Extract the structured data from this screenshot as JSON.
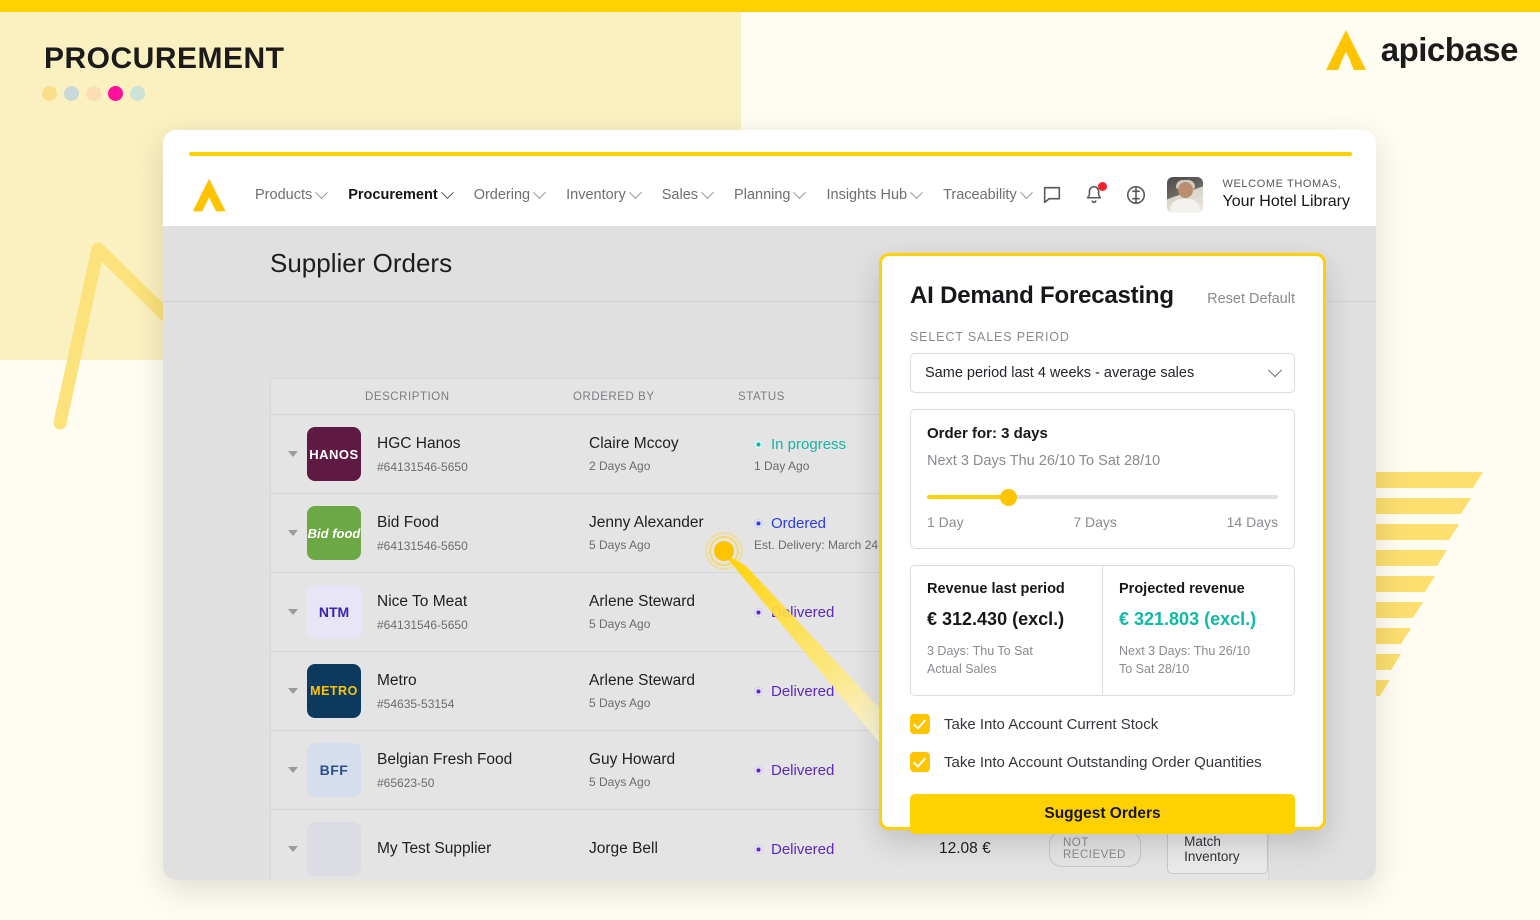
{
  "page": {
    "kicker": "PROCUREMENT",
    "dot_colors": [
      "#FBDE8A",
      "#C8D8DB",
      "#FBDEB2",
      "#FF0F9B",
      "#CBE5D4"
    ],
    "brand_name": "apicbase",
    "accent_yellow": "#FFD100",
    "cream": "#FAF0C0",
    "background": "#FFFDF2"
  },
  "nav": {
    "items": [
      {
        "label": "Products",
        "active": false
      },
      {
        "label": "Procurement",
        "active": true
      },
      {
        "label": "Ordering",
        "active": false
      },
      {
        "label": "Inventory",
        "active": false
      },
      {
        "label": "Sales",
        "active": false
      },
      {
        "label": "Planning",
        "active": false
      },
      {
        "label": "Insights Hub",
        "active": false
      },
      {
        "label": "Traceability",
        "active": false
      }
    ],
    "icons": [
      "chat-icon",
      "notifications-icon",
      "help-icon"
    ],
    "user": {
      "welcome": "WELCOME THOMAS,",
      "organisation": "Your Hotel Library"
    }
  },
  "main": {
    "page_title": "Supplier Orders",
    "table": {
      "columns": [
        "DESCRIPTION",
        "ORDERED BY",
        "STATUS"
      ],
      "rows": [
        {
          "supplier": "HGC Hanos",
          "reference": "#64131546-5650",
          "ordered_by": "Claire Mccoy",
          "ordered_when": "2 Days Ago",
          "status": "In progress",
          "status_color": "#16B3A6",
          "status_sub": "1 Day Ago",
          "logo_text": "HANOS",
          "logo_bg": "#5E1A42",
          "logo_fg": "#FFFFFF"
        },
        {
          "supplier": "Bid Food",
          "reference": "#64131546-5650",
          "ordered_by": "Jenny Alexander",
          "ordered_when": "5 Days Ago",
          "status": "Ordered",
          "status_color": "#2C3BE0",
          "status_sub": "Est. Delivery: March 24",
          "logo_text": "Bid food",
          "logo_bg": "#6CA843",
          "logo_fg": "#FFFFFF"
        },
        {
          "supplier": "Nice To Meat",
          "reference": "#64131546-5650",
          "ordered_by": "Arlene Steward",
          "ordered_when": "5 Days Ago",
          "status": "Delivered",
          "status_color": "#5B27C4",
          "status_sub": "",
          "logo_text": "NTM",
          "logo_bg": "#E8E5F7",
          "logo_fg": "#3B23B0"
        },
        {
          "supplier": "Metro",
          "reference": "#54635-53154",
          "ordered_by": "Arlene Steward",
          "ordered_when": "5 Days Ago",
          "status": "Delivered",
          "status_color": "#5B27C4",
          "status_sub": "",
          "logo_text": "METRO",
          "logo_bg": "#0C3A5E",
          "logo_fg": "#FFC400"
        },
        {
          "supplier": "Belgian Fresh Food",
          "reference": "#65623-50",
          "ordered_by": "Guy Howard",
          "ordered_when": "5 Days Ago",
          "status": "Delivered",
          "status_color": "#5B27C4",
          "status_sub": "",
          "logo_text": "BFF",
          "logo_bg": "#D5DEEC",
          "logo_fg": "#2B4E8C"
        },
        {
          "supplier": "My Test Supplier",
          "reference": "",
          "ordered_by": "Jorge Bell",
          "ordered_when": "",
          "status": "Delivered",
          "status_color": "#5B27C4",
          "status_sub": "",
          "logo_text": "",
          "logo_bg": "#DCDCE4",
          "logo_fg": "#6A6A78",
          "amount": "12.08 €",
          "receipt_badge": "NOT RECIEVED",
          "action_label": "Match Inventory"
        }
      ]
    }
  },
  "ai_panel": {
    "title": "AI Demand Forecasting",
    "reset_label": "Reset Default",
    "select_label": "SELECT SALES PERIOD",
    "select_value": "Same period last 4 weeks - average sales",
    "order_for": "Order for: 3 days",
    "order_range": "Next 3 Days Thu 26/10 To Sat 28/10",
    "slider": {
      "min_label": "1 Day",
      "mid_label": "7 Days",
      "max_label": "14 Days",
      "value": 3,
      "min": 1,
      "max": 14,
      "fill_percent": 23
    },
    "revenue_last": {
      "heading": "Revenue last period",
      "value": "€ 312.430 (excl.)",
      "sub": "3 Days: Thu To Sat\nActual Sales"
    },
    "revenue_projected": {
      "heading": "Projected revenue",
      "value": "€ 321.803 (excl.)",
      "sub": "Next 3 Days: Thu 26/10\nTo Sat 28/10",
      "color": "#0FB9A6"
    },
    "checkbox_1": "Take Into Account Current Stock",
    "checkbox_2": "Take Into Account Outstanding Order Quantities",
    "submit_label": "Suggest Orders"
  }
}
